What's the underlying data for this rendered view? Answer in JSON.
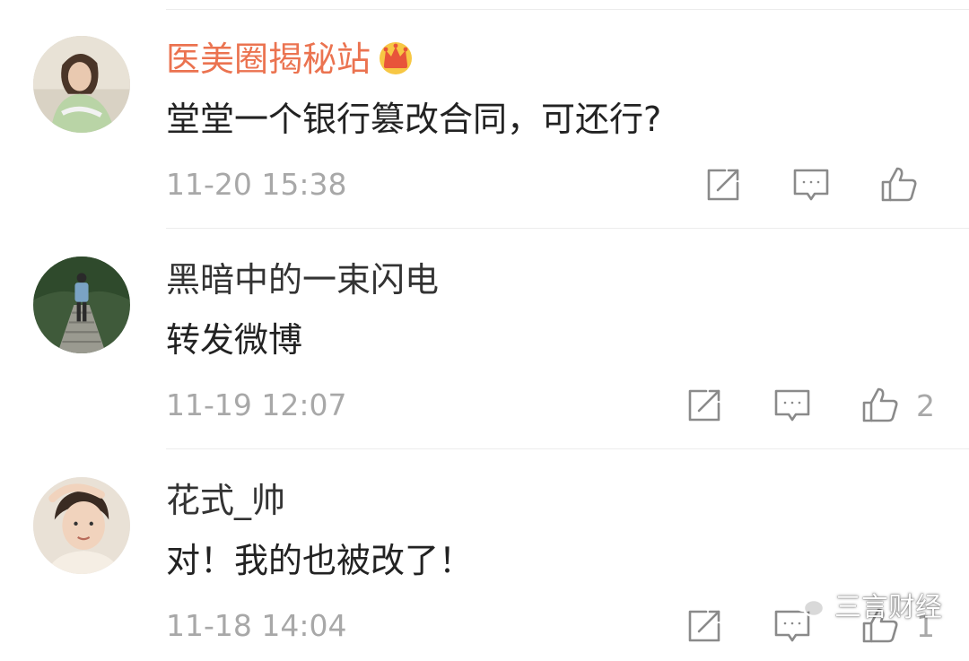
{
  "comments": [
    {
      "username": "医美圈揭秘站",
      "vip": true,
      "badge_icon": "crown-icon",
      "text": "堂堂一个银行篡改合同，可还行?",
      "time": "11-20 15:38",
      "likes": ""
    },
    {
      "username": "黑暗中的一束闪电",
      "vip": false,
      "text": "转发微博",
      "time": "11-19 12:07",
      "likes": "2"
    },
    {
      "username": "花式_帅",
      "vip": false,
      "text": "对！我的也被改了！",
      "time": "11-18 14:04",
      "likes": "1"
    }
  ],
  "icons": {
    "share": "share-icon",
    "reply": "comment-icon",
    "like": "thumbs-up-icon"
  },
  "watermark": {
    "icon": "wechat-icon",
    "text": "三言财经"
  },
  "colors": {
    "vip_name": "#eb7350",
    "name": "#333333",
    "text": "#222222",
    "meta": "#a8a8a8",
    "divider": "#ececec"
  }
}
